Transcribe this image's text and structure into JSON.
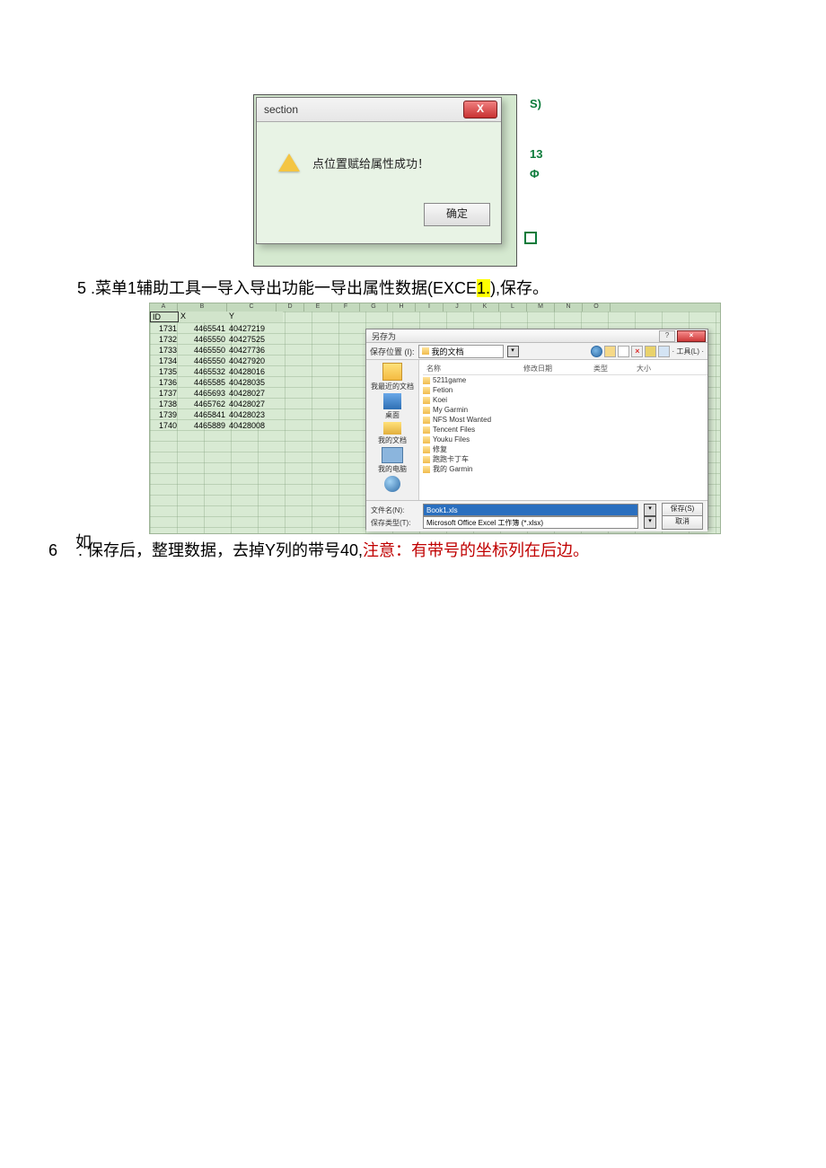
{
  "dialog": {
    "title": "section",
    "close": "X",
    "message": "点位置赋给属性成功！",
    "ok": "确定"
  },
  "side_ann": {
    "s": "S)",
    "n13": "13",
    "phi": "Φ"
  },
  "line5": {
    "num": "5",
    "text_a": " .菜单1辅助工具一导入导出功能一导出属性数据(EXCE",
    "hl": "1.",
    "text_b": "),保存。"
  },
  "sheet": {
    "hdr": {
      "id": "ID",
      "x": "X",
      "y": "Y"
    },
    "rows": [
      {
        "a": "1731",
        "b": "4465541",
        "c": "40427219"
      },
      {
        "a": "1732",
        "b": "4465550",
        "c": "40427525"
      },
      {
        "a": "1733",
        "b": "4465550",
        "c": "40427736"
      },
      {
        "a": "1734",
        "b": "4465550",
        "c": "40427920"
      },
      {
        "a": "1735",
        "b": "4465532",
        "c": "40428016"
      },
      {
        "a": "1736",
        "b": "4465585",
        "c": "40428035"
      },
      {
        "a": "1737",
        "b": "4465693",
        "c": "40428027"
      },
      {
        "a": "1738",
        "b": "4465762",
        "c": "40428027"
      },
      {
        "a": "1739",
        "b": "4465841",
        "c": "40428023"
      },
      {
        "a": "1740",
        "b": "4465889",
        "c": "40428008"
      }
    ]
  },
  "saveas": {
    "title": "另存为",
    "help": "?",
    "close": "×",
    "loc_label": "保存位置 (I):",
    "loc_value": "我的文档",
    "tools_label": "· 工具(L) ·",
    "listhdr": {
      "name": "名称",
      "date": "修改日期",
      "type": "类型",
      "size": "大小"
    },
    "shortcuts": {
      "recent": "我最近的文档",
      "desktop": "桌面",
      "mydocs": "我的文档",
      "mypc": "我的电脑",
      "net": ""
    },
    "files": [
      "5211game",
      "Fetion",
      "Koei",
      "My Garmin",
      "NFS Most Wanted",
      "Tencent Files",
      "Youku Files",
      "修复",
      "跑跑卡丁车",
      "我的 Garmin"
    ],
    "fname_label": "文件名(N):",
    "fname_value": "Book1.xls",
    "ftype_label": "保存类型(T):",
    "ftype_value": "Microsoft Office Excel 工作簿 (*.xlsx)",
    "save_btn": "保存(S)",
    "cancel_btn": "取消"
  },
  "ru": "如",
  "line6": {
    "num": "6",
    "a": " . 保存后，整理数据，去掉Y列的带号40,",
    "red": "注意：有带号的坐标列在后边。"
  }
}
